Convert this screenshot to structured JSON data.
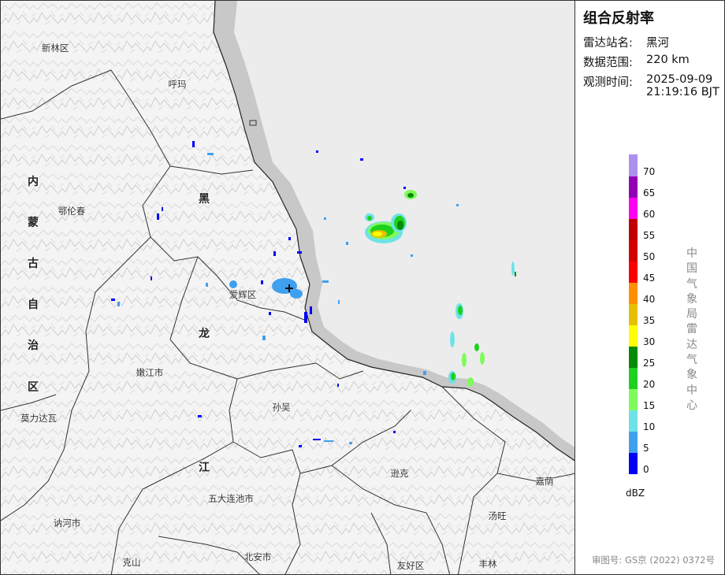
{
  "product": {
    "title": "组合反射率",
    "station_label": "雷达站名:",
    "station_value": "黑河",
    "range_label": "数据范围:",
    "range_value": "220 km",
    "time_label": "观测时间:",
    "time_date": "2025-09-09",
    "time_clock": "21:19:16 BJT"
  },
  "map": {
    "places": [
      {
        "name": "新林区"
      },
      {
        "name": "呼玛"
      },
      {
        "name": "鄂伦春"
      },
      {
        "name": "爱辉区"
      },
      {
        "name": "嫩江市"
      },
      {
        "name": "莫力达瓦"
      },
      {
        "name": "孙吴"
      },
      {
        "name": "逊克"
      },
      {
        "name": "嘉荫"
      },
      {
        "name": "五大连池市"
      },
      {
        "name": "讷河市"
      },
      {
        "name": "汤旺"
      },
      {
        "name": "克山"
      },
      {
        "name": "北安市"
      },
      {
        "name": "友好区"
      },
      {
        "name": "丰林"
      }
    ],
    "province_chars": [
      "内",
      "蒙",
      "古",
      "自",
      "治",
      "区",
      "黑",
      "龙",
      "江"
    ]
  },
  "legend": {
    "unit": "dBZ",
    "bins": [
      {
        "value": "0",
        "color": "#0000f6"
      },
      {
        "value": "5",
        "color": "#3fa0f0"
      },
      {
        "value": "10",
        "color": "#6ee2e6"
      },
      {
        "value": "15",
        "color": "#80fb5c"
      },
      {
        "value": "20",
        "color": "#1fd11f"
      },
      {
        "value": "25",
        "color": "#058b05"
      },
      {
        "value": "30",
        "color": "#ffff00"
      },
      {
        "value": "35",
        "color": "#e6c000"
      },
      {
        "value": "40",
        "color": "#ff8f00"
      },
      {
        "value": "45",
        "color": "#ff0000"
      },
      {
        "value": "50",
        "color": "#d20000"
      },
      {
        "value": "55",
        "color": "#c00000"
      },
      {
        "value": "60",
        "color": "#ff00f0"
      },
      {
        "value": "65",
        "color": "#9400b4"
      },
      {
        "value": "70",
        "color": "#ac90f0"
      }
    ]
  },
  "agency": "中国气象局雷达气象中心",
  "map_approval": "审图号: GS京 (2022) 0372号"
}
